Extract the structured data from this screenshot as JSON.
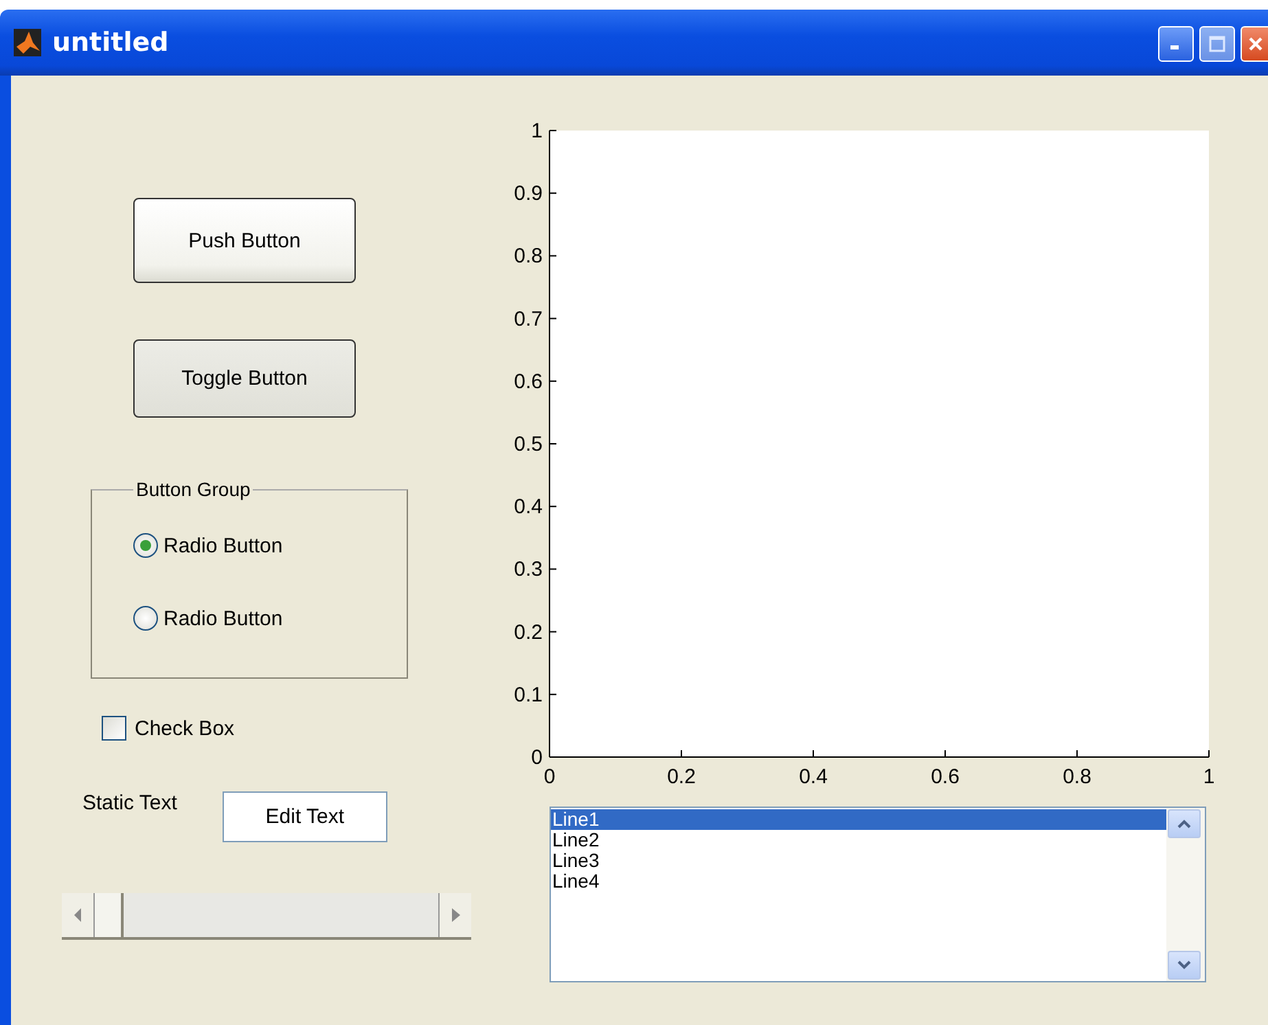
{
  "window": {
    "title": "untitled"
  },
  "push_button": {
    "label": "Push Button"
  },
  "toggle_button": {
    "label": "Toggle Button",
    "pressed": false
  },
  "button_group": {
    "title": "Button Group",
    "radios": [
      {
        "label": "Radio Button",
        "selected": true
      },
      {
        "label": "Radio Button",
        "selected": false
      }
    ]
  },
  "check_box": {
    "label": "Check Box",
    "checked": false
  },
  "static_text": "Static Text",
  "edit_text": {
    "value": "Edit Text"
  },
  "slider": {
    "level": 0
  },
  "axes": {
    "chart_data": {
      "type": "line",
      "xlim": [
        0,
        1
      ],
      "ylim": [
        0,
        1
      ],
      "xticks": [
        0,
        0.2,
        0.4,
        0.6,
        0.8,
        1
      ],
      "yticks": [
        0,
        0.1,
        0.2,
        0.3,
        0.4,
        0.5,
        0.6,
        0.7,
        0.8,
        0.9,
        1
      ]
    }
  },
  "listbox": {
    "items": [
      {
        "label": "Line1",
        "selected": true
      },
      {
        "label": "Line2",
        "selected": false
      },
      {
        "label": "Line3",
        "selected": false
      },
      {
        "label": "Line4",
        "selected": false
      }
    ]
  }
}
